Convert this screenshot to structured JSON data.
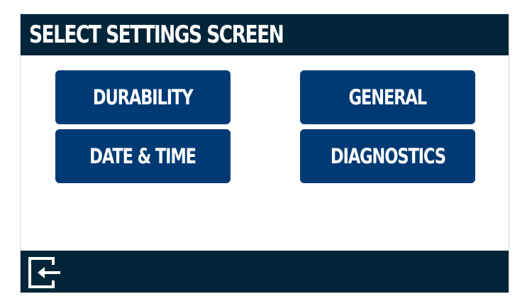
{
  "header": {
    "title": "SELECT SETTINGS SCREEN"
  },
  "buttons": {
    "durability": "DURABILITY",
    "general": "GENERAL",
    "date_time": "DATE & TIME",
    "diagnostics": "DIAGNOSTICS"
  },
  "footer": {
    "exit_icon": "exit-icon"
  },
  "colors": {
    "header_bg": "#03253a",
    "button_bg": "#003a75",
    "text": "#ffffff",
    "background": "#ffffff"
  }
}
